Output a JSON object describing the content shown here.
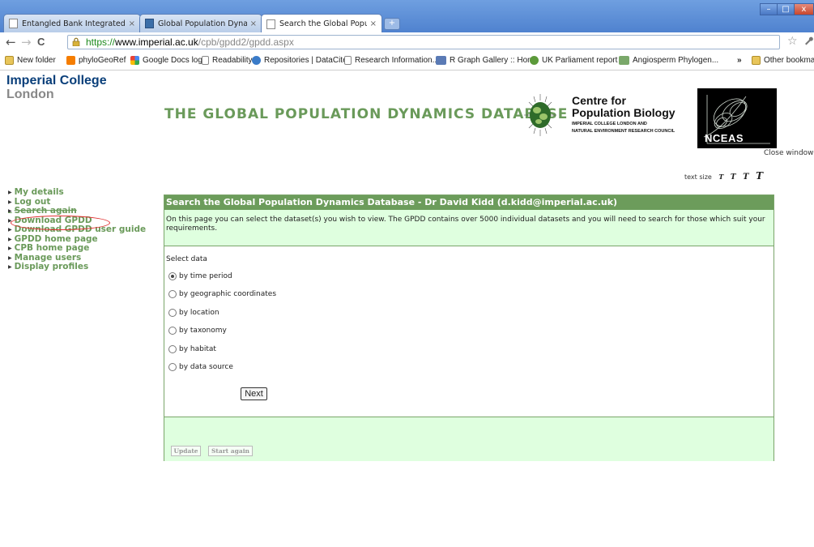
{
  "browser": {
    "tabs": [
      {
        "title": "Entangled Bank Integrated...",
        "close": "×"
      },
      {
        "title": "Global Population Dynamics...",
        "close": "×"
      },
      {
        "title": "Search the Global Populatio...",
        "close": "×"
      }
    ],
    "new_tab": "+",
    "window_controls": {
      "minimize": "–",
      "maximize": "□",
      "close": "x"
    },
    "url": {
      "scheme": "https://",
      "host": "www.imperial.ac.uk",
      "path": "/cpb/gpdd2/gpdd.aspx"
    },
    "nav": {
      "back": "←",
      "forward": "→",
      "reload": "C",
      "star": "☆",
      "wrench": "🔧"
    },
    "bookmarks": [
      {
        "label": "New folder",
        "icon": "folder-icon",
        "color": "#e8c55a"
      },
      {
        "label": "phyloGeoRef",
        "icon": "blogger-icon",
        "color": "#f57d00"
      },
      {
        "label": "Google Docs logo",
        "icon": "google-icon",
        "color": "#4a8af4"
      },
      {
        "label": "Readability",
        "icon": "page-icon",
        "color": "#ffffff"
      },
      {
        "label": "Repositories | DataCite",
        "icon": "datacite-icon",
        "color": "#3a7bc8"
      },
      {
        "label": "Research Information...",
        "icon": "page-icon",
        "color": "#ffffff"
      },
      {
        "label": "R Graph Gallery :: Home",
        "icon": "r-icon",
        "color": "#5a7ab5"
      },
      {
        "label": "UK Parliament report ...",
        "icon": "parliament-icon",
        "color": "#5c9a3a"
      },
      {
        "label": "Angiosperm Phylogen...",
        "icon": "angio-icon",
        "color": "#7aa86a"
      }
    ],
    "bookmarks_overflow": "»",
    "other_bookmarks": "Other bookmarks"
  },
  "header": {
    "college_line1": "Imperial College",
    "college_line2": "London",
    "db_title": "THE GLOBAL POPULATION DYNAMICS DATABASE",
    "cpb_title_line1": "Centre for",
    "cpb_title_line2": "Population Biology",
    "cpb_sub_line1": "IMPERIAL COLLEGE LONDON AND",
    "cpb_sub_line2": "NATURAL ENVIRONMENT RESEARCH COUNCIL",
    "nceas_label": "NCEAS",
    "close_window": "Close window",
    "text_size_label": "text size",
    "text_size_options": [
      "T",
      "T",
      "T",
      "T"
    ]
  },
  "sidenav": {
    "items": [
      {
        "label": "My details",
        "strike": false
      },
      {
        "label": "Log out",
        "strike": false
      },
      {
        "label": "Search again",
        "strike": true
      },
      {
        "label": "Download GPDD",
        "strike": false
      },
      {
        "label": "Download GPDD user guide",
        "strike": false
      },
      {
        "label": "GPDD home page",
        "strike": false
      },
      {
        "label": "CPB home page",
        "strike": false
      },
      {
        "label": "Manage users",
        "strike": false
      },
      {
        "label": "Display profiles",
        "strike": false
      }
    ]
  },
  "panel": {
    "header": "Search the Global Population Dynamics Database - Dr David Kidd (d.kidd@imperial.ac.uk)",
    "intro": "On this page you can select the dataset(s) you wish to view. The GPDD contains over 5000 individual datasets and you will need to search for those which suit your requirements.",
    "select_label": "Select data",
    "options": [
      {
        "label": "by time period",
        "checked": true
      },
      {
        "label": "by geographic coordinates",
        "checked": false
      },
      {
        "label": "by location",
        "checked": false
      },
      {
        "label": "by taxonomy",
        "checked": false
      },
      {
        "label": "by habitat",
        "checked": false
      },
      {
        "label": "by data source",
        "checked": false
      }
    ],
    "next_button": "Next",
    "update_button": "Update",
    "start_again_button": "Start again"
  },
  "colors": {
    "accent_green": "#6c9c5b",
    "panel_bg": "#dfffdf",
    "college_blue": "#0a3f7a",
    "highlight_red": "#e03030"
  }
}
